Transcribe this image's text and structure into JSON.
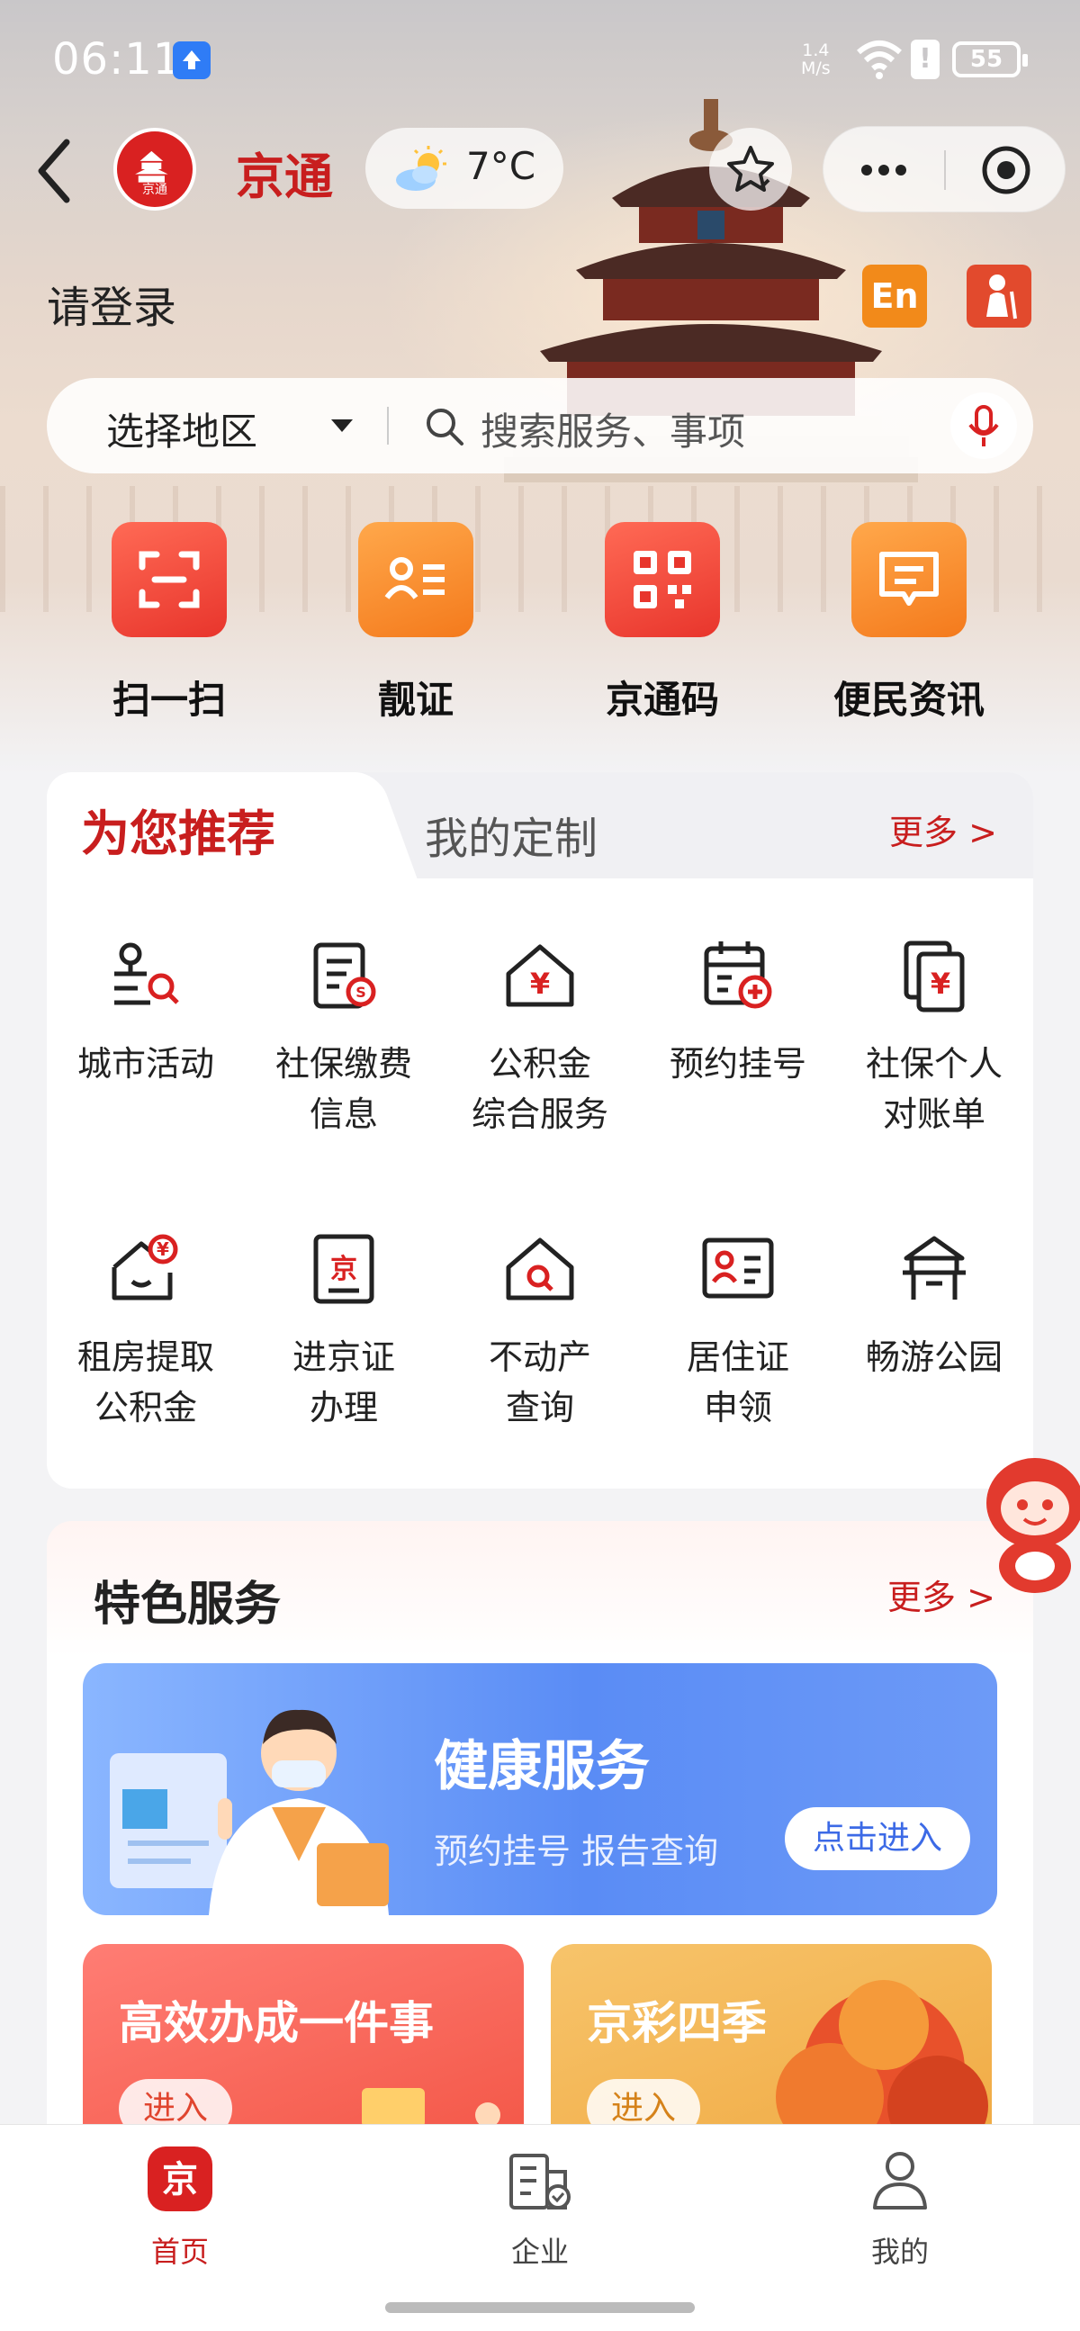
{
  "status_bar": {
    "time": "06:11",
    "net_speed_top": "1.4",
    "net_speed_unit": "M/s",
    "battery": "55"
  },
  "header": {
    "app_name": "京通",
    "logo_text": "京通",
    "temperature": "7°C"
  },
  "user": {
    "login_prompt": "请登录",
    "lang_button": "En"
  },
  "search": {
    "region_label": "选择地区",
    "placeholder": "搜索服务、事项"
  },
  "quick_actions": [
    {
      "label": "扫一扫",
      "icon": "scan-icon"
    },
    {
      "label": "靓证",
      "icon": "id-card-icon"
    },
    {
      "label": "京通码",
      "icon": "qr-code-icon"
    },
    {
      "label": "便民资讯",
      "icon": "news-icon"
    }
  ],
  "recommend": {
    "tab_active": "为您推荐",
    "tab_inactive": "我的定制",
    "more": "更多 >",
    "services": [
      {
        "line1": "城市活动",
        "line2": "",
        "icon": "city-activity-icon"
      },
      {
        "line1": "社保缴费",
        "line2": "信息",
        "icon": "social-security-payment-icon"
      },
      {
        "line1": "公积金",
        "line2": "综合服务",
        "icon": "housing-fund-icon"
      },
      {
        "line1": "预约挂号",
        "line2": "",
        "icon": "appointment-icon"
      },
      {
        "line1": "社保个人",
        "line2": "对账单",
        "icon": "social-security-statement-icon"
      },
      {
        "line1": "租房提取",
        "line2": "公积金",
        "icon": "rent-withdraw-icon"
      },
      {
        "line1": "进京证",
        "line2": "办理",
        "icon": "beijing-permit-icon"
      },
      {
        "line1": "不动产",
        "line2": "查询",
        "icon": "real-estate-search-icon"
      },
      {
        "line1": "居住证",
        "line2": "申领",
        "icon": "residence-permit-icon"
      },
      {
        "line1": "畅游公园",
        "line2": "",
        "icon": "park-icon"
      }
    ]
  },
  "featured": {
    "title": "特色服务",
    "more": "更多 >",
    "health": {
      "title": "健康服务",
      "subtitle": "预约挂号 报告查询",
      "button": "点击进入"
    },
    "cards": [
      {
        "title": "高效办成一件事",
        "button": "进入"
      },
      {
        "title": "京彩四季",
        "button": "进入"
      }
    ]
  },
  "bottom_nav": [
    {
      "label": "首页",
      "icon": "home-jing-icon",
      "active": true
    },
    {
      "label": "企业",
      "icon": "enterprise-icon",
      "active": false
    },
    {
      "label": "我的",
      "icon": "profile-icon",
      "active": false
    }
  ],
  "colors": {
    "brand_red": "#c81e1e",
    "orange": "#f47a1c",
    "health_blue": "#5a8cf5"
  }
}
